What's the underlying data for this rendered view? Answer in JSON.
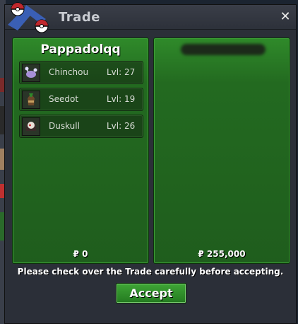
{
  "window": {
    "title": "Trade",
    "close_label": "✕"
  },
  "left_panel": {
    "owner": "Pappadolqq",
    "items": [
      {
        "name": "Chinchou",
        "level": "Lvl: 27",
        "icon": "chinchou-sprite"
      },
      {
        "name": "Seedot",
        "level": "Lvl: 19",
        "icon": "seedot-sprite"
      },
      {
        "name": "Duskull",
        "level": "Lvl: 26",
        "icon": "duskull-sprite"
      }
    ],
    "money": "₽ 0"
  },
  "right_panel": {
    "owner": "",
    "money": "₽ 255,000"
  },
  "footer": {
    "notice": "Please check over the Trade carefully before accepting.",
    "accept_label": "Accept"
  }
}
